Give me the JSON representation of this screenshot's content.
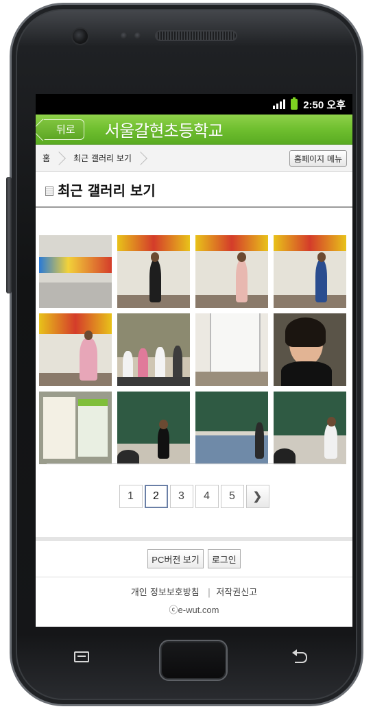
{
  "status_bar": {
    "time": "2:50 오후",
    "icons": [
      "signal-icon",
      "battery-icon"
    ]
  },
  "header": {
    "back_label": "뒤로",
    "site_title": "서울갈현초등학교"
  },
  "breadcrumb": {
    "home": "홈",
    "current": "최근 갤러리 보기",
    "menu_button": "홈페이지 메뉴"
  },
  "page": {
    "title": "최근 갤러리 보기",
    "title_icon": "document-icon"
  },
  "gallery": {
    "photo_count": 12,
    "photos": [
      "hall-banner-photo",
      "student-speaking-photo",
      "student-speaking-photo-2",
      "student-speaking-photo-3",
      "student-mic-photo",
      "classroom-group-photo",
      "classroom-curtain-photo",
      "teacher-mic-photo",
      "poster-board-photo",
      "blackboard-student-photo",
      "classroom-students-photo",
      "blackboard-student-photo-2"
    ]
  },
  "pagination": {
    "pages": [
      "1",
      "2",
      "3",
      "4",
      "5"
    ],
    "current": "2",
    "next_icon": "chevron-right-icon"
  },
  "footer": {
    "pc_version": "PC버전 보기",
    "login": "로그인",
    "privacy": "개인 정보보호방침",
    "separator": "|",
    "copyright_report": "저작권신고",
    "copyright": "ⓒe-wut.com"
  },
  "colors": {
    "accent": "#6fbf2f",
    "status_bar": "#000000",
    "current_page_border": "#6a7fa6"
  }
}
